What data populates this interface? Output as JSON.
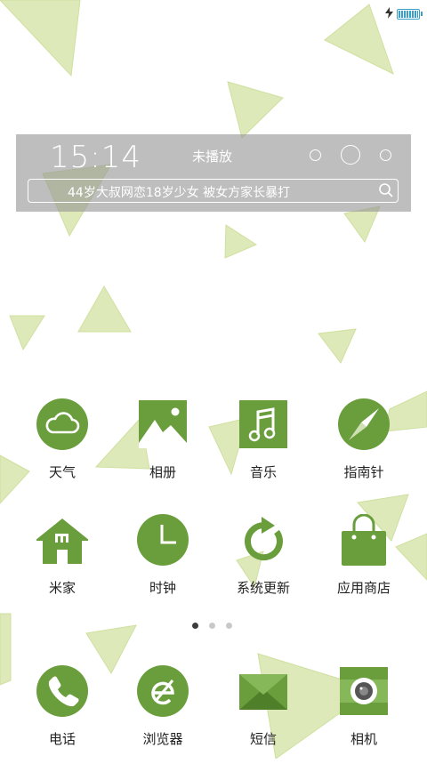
{
  "colors": {
    "accent": "#6a9e3d",
    "triangle": "#dde9b8",
    "widget_bg": "#9a9a9a"
  },
  "status_bar": {
    "charging_icon": "bolt-icon",
    "battery_icon": "battery-icon"
  },
  "widget": {
    "time": "15:14",
    "music_status": "未播放",
    "search_text": "44岁大叔网恋18岁少女 被女方家长暴打"
  },
  "apps_row1": [
    {
      "label": "天气",
      "icon": "cloud-icon"
    },
    {
      "label": "相册",
      "icon": "gallery-icon"
    },
    {
      "label": "音乐",
      "icon": "music-note-icon"
    },
    {
      "label": "指南针",
      "icon": "compass-icon"
    }
  ],
  "apps_row2": [
    {
      "label": "米家",
      "icon": "home-icon"
    },
    {
      "label": "时钟",
      "icon": "clock-icon"
    },
    {
      "label": "系统更新",
      "icon": "refresh-icon"
    },
    {
      "label": "应用商店",
      "icon": "shopping-bag-icon"
    }
  ],
  "page_indicator": {
    "current": 1,
    "total": 3
  },
  "dock": [
    {
      "label": "电话",
      "icon": "phone-icon"
    },
    {
      "label": "浏览器",
      "icon": "browser-icon"
    },
    {
      "label": "短信",
      "icon": "envelope-icon"
    },
    {
      "label": "相机",
      "icon": "camera-icon"
    }
  ]
}
